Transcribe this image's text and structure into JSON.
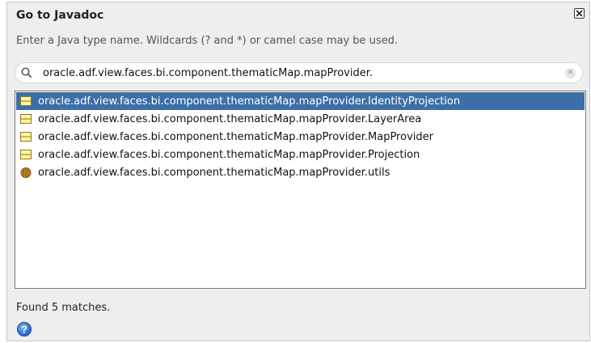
{
  "dialog": {
    "title": "Go to Javadoc",
    "close_icon": "close-icon",
    "instructions": "Enter a Java type name.  Wildcards (? and *) or camel case may be used."
  },
  "search": {
    "icon": "search-icon",
    "value": "oracle.adf.view.faces.bi.component.thematicMap.mapProvider.",
    "clear_icon": "clear-icon",
    "clear_glyph": "✕"
  },
  "results": [
    {
      "label": "oracle.adf.view.faces.bi.component.thematicMap.mapProvider.IdentityProjection",
      "icon": "class-icon",
      "selected": true
    },
    {
      "label": "oracle.adf.view.faces.bi.component.thematicMap.mapProvider.LayerArea",
      "icon": "class-icon",
      "selected": false
    },
    {
      "label": "oracle.adf.view.faces.bi.component.thematicMap.mapProvider.MapProvider",
      "icon": "class-icon",
      "selected": false
    },
    {
      "label": "oracle.adf.view.faces.bi.component.thematicMap.mapProvider.Projection",
      "icon": "class-icon",
      "selected": false
    },
    {
      "label": "oracle.adf.view.faces.bi.component.thematicMap.mapProvider.utils",
      "icon": "package-icon",
      "selected": false
    }
  ],
  "status": {
    "text": "Found 5 matches."
  },
  "help": {
    "icon": "help-icon",
    "glyph": "?"
  },
  "colors": {
    "selection": "#3c6fa7",
    "dialog_background": "#eeeeee",
    "help_blue": "#1f5fc4"
  }
}
